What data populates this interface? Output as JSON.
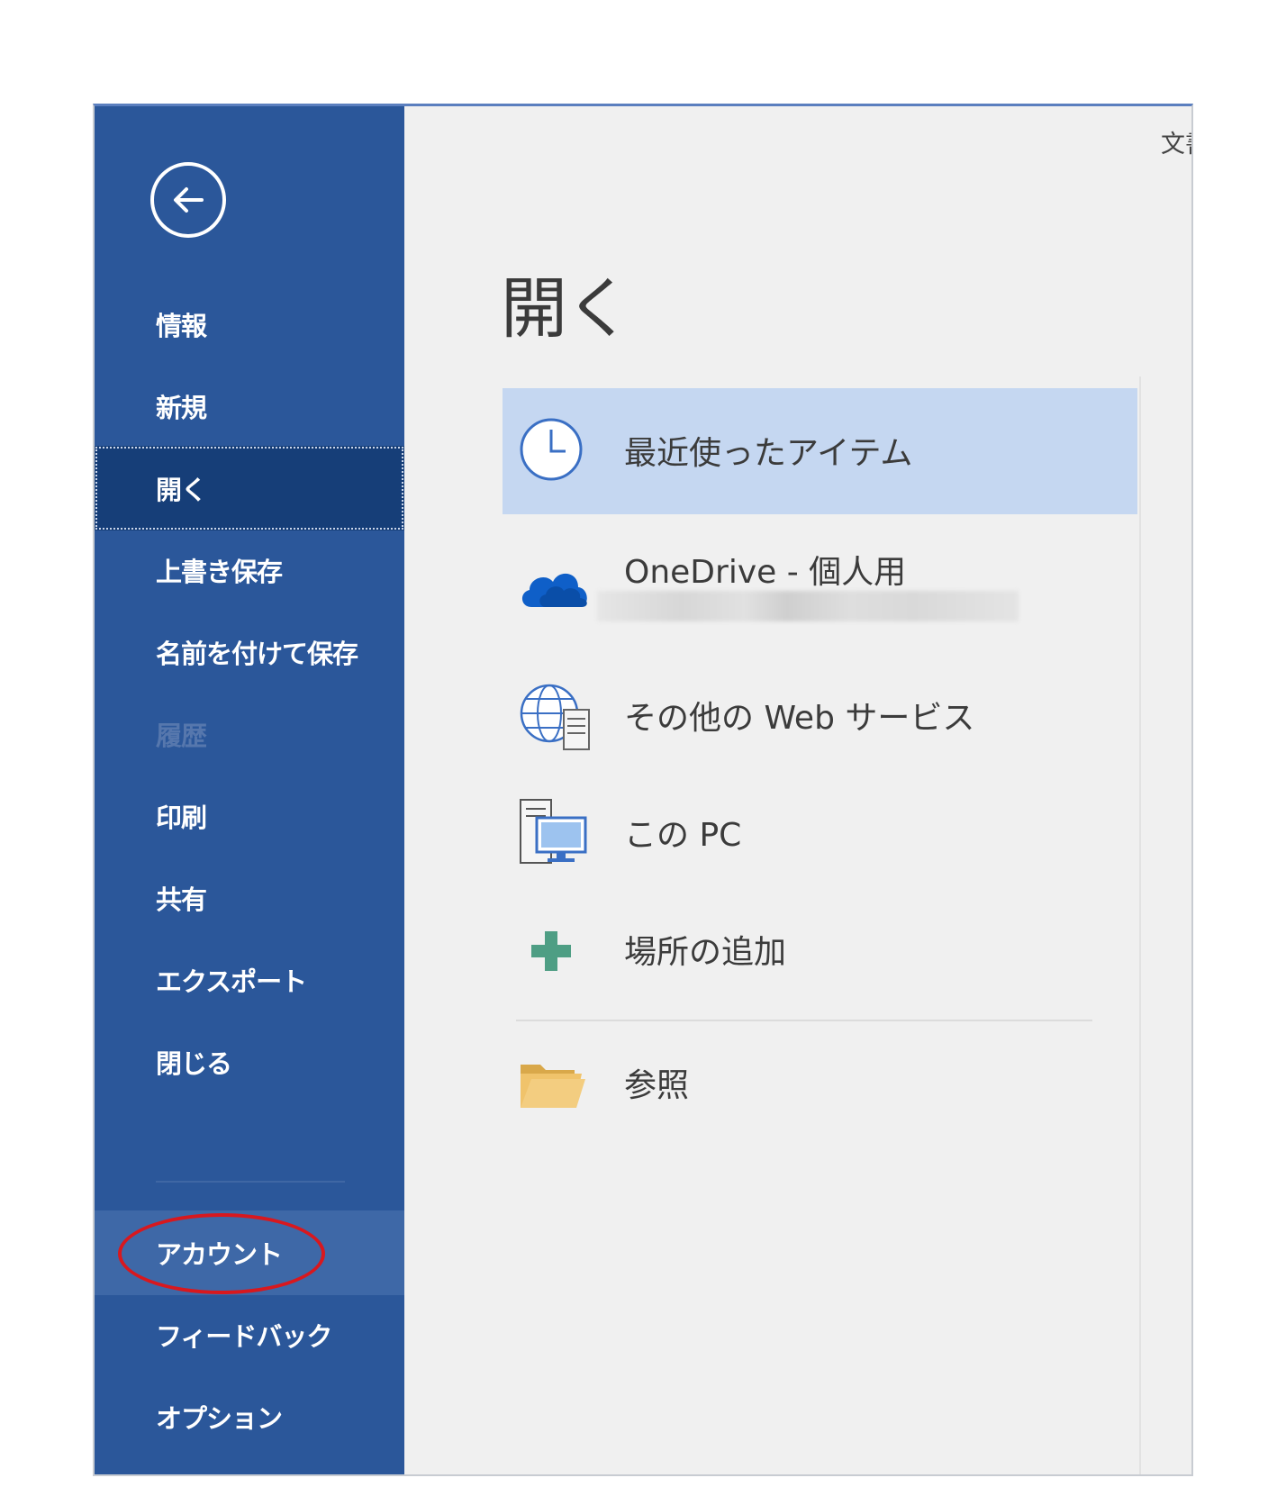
{
  "sidebar": {
    "items": [
      {
        "label": "情報"
      },
      {
        "label": "新規"
      },
      {
        "label": "開く"
      },
      {
        "label": "上書き保存"
      },
      {
        "label": "名前を付けて保存"
      },
      {
        "label": "履歴"
      },
      {
        "label": "印刷"
      },
      {
        "label": "共有"
      },
      {
        "label": "エクスポート"
      },
      {
        "label": "閉じる"
      },
      {
        "label": "アカウント"
      },
      {
        "label": "フィードバック"
      },
      {
        "label": "オプション"
      }
    ],
    "selected": "開く",
    "disabled": "履歴",
    "highlighted": "アカウント"
  },
  "main": {
    "title": "開く",
    "corner_text": "文書",
    "locations": [
      {
        "label": "最近使ったアイテム",
        "icon": "clock-icon"
      },
      {
        "label": "OneDrive - 個人用",
        "icon": "onedrive-cloud-icon"
      },
      {
        "label": "その他の Web サービス",
        "icon": "globe-server-icon"
      },
      {
        "label": "この PC",
        "icon": "pc-monitor-icon"
      },
      {
        "label": "場所の追加",
        "icon": "plus-icon"
      },
      {
        "label": "参照",
        "icon": "folder-icon"
      }
    ]
  },
  "colors": {
    "sidebar_bg": "#2b579a",
    "sidebar_selected": "#163e78",
    "sidebar_hover": "#3e68a7",
    "main_bg": "#f0f0f0",
    "recent_highlight": "#c5d7f1",
    "annotation_circle": "#d8181e"
  }
}
